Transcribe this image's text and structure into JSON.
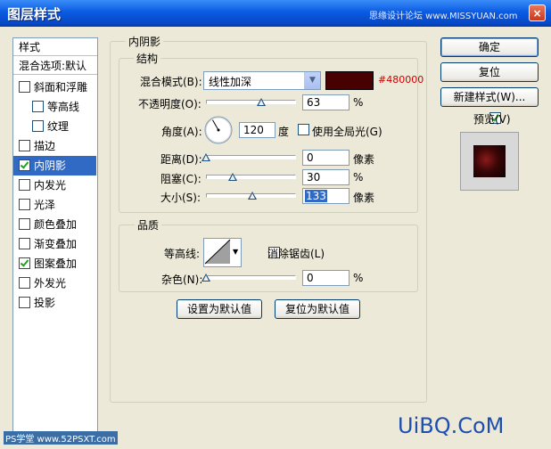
{
  "window": {
    "title": "图层样式",
    "watermark_top": "思缘设计论坛  www.MISSYUAN.com",
    "close_glyph": "×"
  },
  "sidebar": {
    "header": "样式",
    "blend_options": "混合选项:默认",
    "items": [
      {
        "label": "斜面和浮雕",
        "checked": false,
        "selected": false,
        "indent": false
      },
      {
        "label": "等高线",
        "checked": false,
        "selected": false,
        "indent": true
      },
      {
        "label": "纹理",
        "checked": false,
        "selected": false,
        "indent": true
      },
      {
        "label": "描边",
        "checked": false,
        "selected": false,
        "indent": false
      },
      {
        "label": "内阴影",
        "checked": true,
        "selected": true,
        "indent": false
      },
      {
        "label": "内发光",
        "checked": false,
        "selected": false,
        "indent": false
      },
      {
        "label": "光泽",
        "checked": false,
        "selected": false,
        "indent": false
      },
      {
        "label": "颜色叠加",
        "checked": false,
        "selected": false,
        "indent": false
      },
      {
        "label": "渐变叠加",
        "checked": false,
        "selected": false,
        "indent": false
      },
      {
        "label": "图案叠加",
        "checked": true,
        "selected": false,
        "indent": false
      },
      {
        "label": "外发光",
        "checked": false,
        "selected": false,
        "indent": false
      },
      {
        "label": "投影",
        "checked": false,
        "selected": false,
        "indent": false
      }
    ]
  },
  "inner_shadow": {
    "group_title": "内阴影",
    "structure_title": "结构",
    "blend_mode_label": "混合模式(B):",
    "blend_mode_value": "线性加深",
    "color_hex_text": "#480000",
    "shadow_color": "#480000",
    "opacity_label": "不透明度(O):",
    "opacity_value": "63",
    "opacity_unit": "%",
    "opacity_level": 0.63,
    "angle_label": "角度(A):",
    "angle_value": "120",
    "angle_unit": "度",
    "global_light_label": "使用全局光(G)",
    "global_light_checked": false,
    "distance_label": "距离(D):",
    "distance_value": "0",
    "distance_unit": "像素",
    "distance_level": 0.0,
    "choke_label": "阻塞(C):",
    "choke_value": "30",
    "choke_unit": "%",
    "choke_level": 0.3,
    "size_label": "大小(S):",
    "size_value": "133",
    "size_unit": "像素",
    "size_level": 0.53
  },
  "quality": {
    "title": "品质",
    "contour_label": "等高线:",
    "antialias_label": "消除锯齿(L)",
    "antialias_checked": false,
    "noise_label": "杂色(N):",
    "noise_value": "0",
    "noise_unit": "%",
    "noise_level": 0.0
  },
  "defaults": {
    "make_default": "设置为默认值",
    "reset_default": "复位为默认值"
  },
  "buttons": {
    "ok": "确定",
    "reset": "复位",
    "new_style": "新建样式(W)...",
    "preview_label": "预览(V)",
    "preview_checked": true
  },
  "watermarks": {
    "bottom_left": "PS学堂  www.52PSXT.com",
    "bottom_right": "UiBQ.CoM"
  },
  "colors": {
    "selection": "#316AC5",
    "titlebar": "#0A5BE2",
    "hex_text": "#CC0000"
  }
}
